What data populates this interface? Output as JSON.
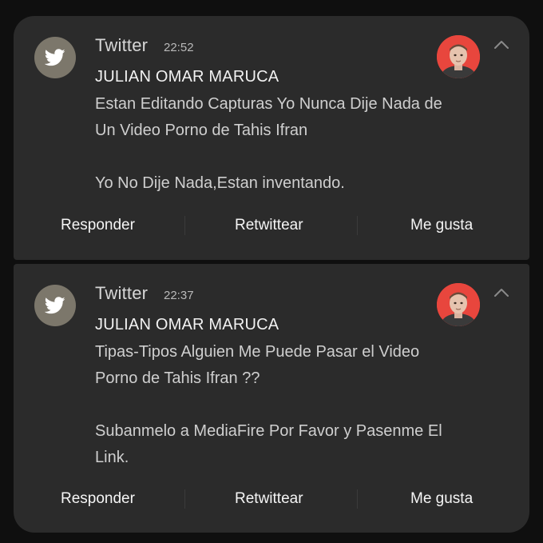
{
  "notifications": [
    {
      "app_name": "Twitter",
      "time": "22:52",
      "sender": "JULIAN OMAR MARUCA",
      "message_lines": [
        "Estan Editando Capturas Yo Nunca Dije Nada de",
        "Un Video Porno de Tahis Ifran",
        "",
        "Yo No Dije Nada,Estan inventando."
      ],
      "actions": [
        "Responder",
        "Retwittear",
        "Me gusta"
      ]
    },
    {
      "app_name": "Twitter",
      "time": "22:37",
      "sender": "JULIAN OMAR MARUCA",
      "message_lines": [
        "Tipas-Tipos Alguien Me Puede Pasar el Video",
        "Porno de Tahis Ifran ??",
        "",
        "Subanmelo a MediaFire Por Favor y Pasenme El",
        "Link."
      ],
      "actions": [
        "Responder",
        "Retwittear",
        "Me gusta"
      ]
    }
  ],
  "icons": {
    "app": "twitter-bird-icon",
    "expand": "chevron-up-icon",
    "avatar": "profile-photo"
  },
  "colors": {
    "background": "#0f0f0f",
    "card": "#2b2b2b",
    "app_icon_bg": "#7c776b",
    "avatar_bg": "#e8463d"
  }
}
